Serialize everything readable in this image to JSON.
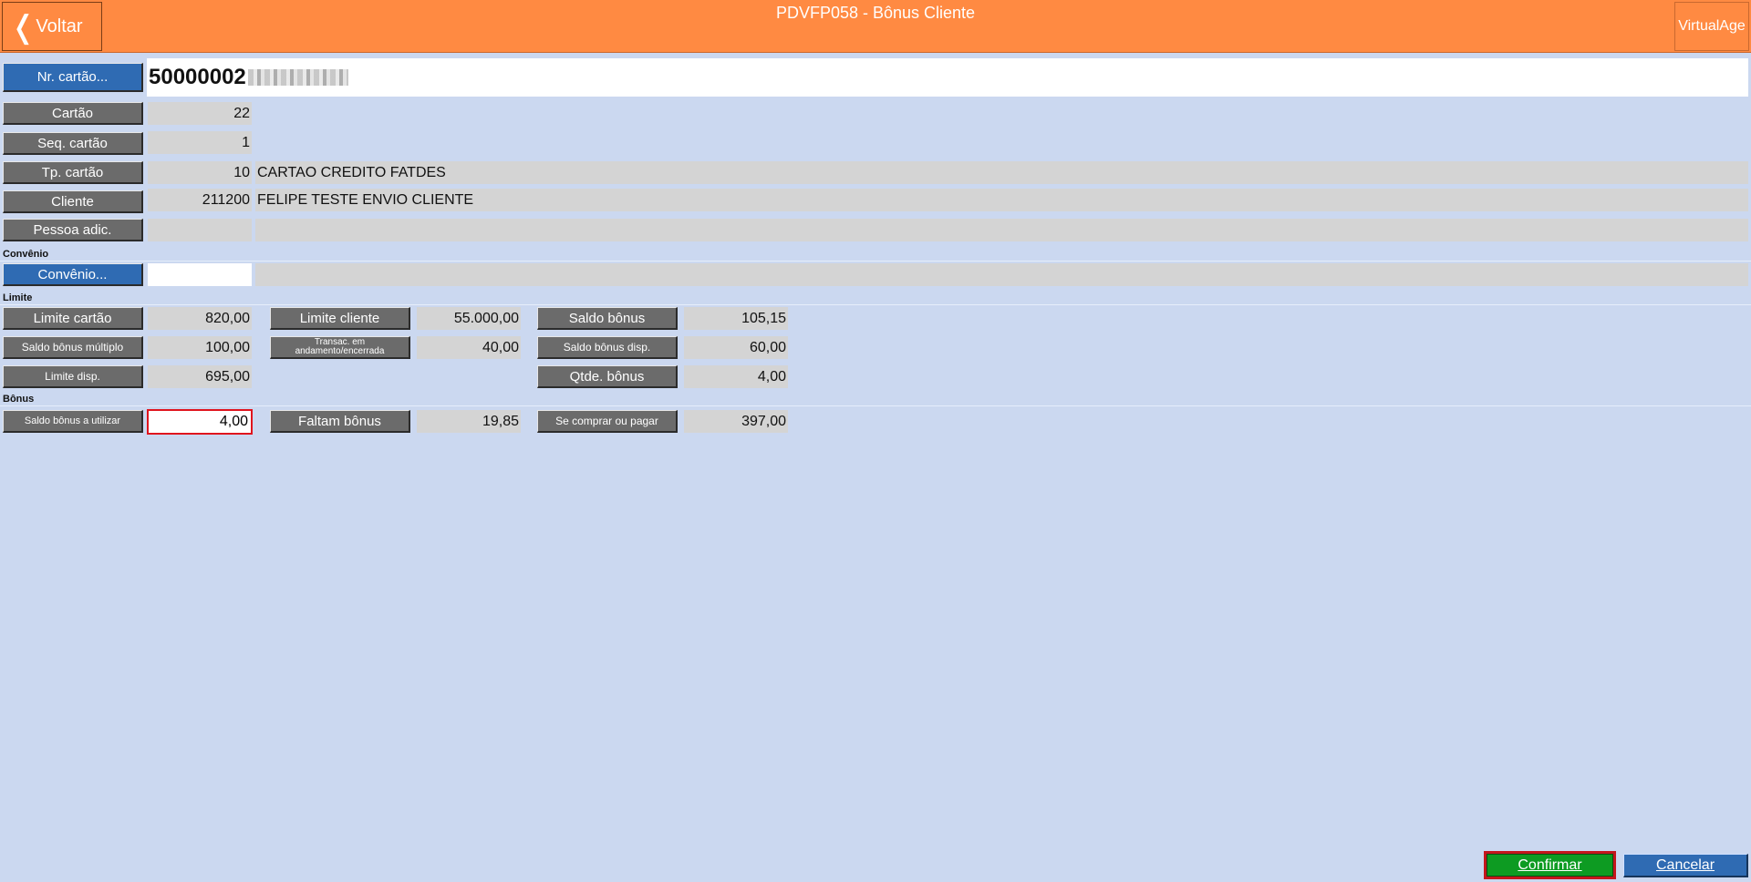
{
  "header": {
    "back_label": "Voltar",
    "title": "PDVFP058 - Bônus Cliente",
    "brand": "VirtualAge",
    "color": "#ff8a42"
  },
  "card": {
    "label": "Nr. cartão...",
    "value": "50000002"
  },
  "fields": {
    "cartao": {
      "label": "Cartão",
      "value": "22"
    },
    "seq_cartao": {
      "label": "Seq. cartão",
      "value": "1"
    },
    "tp_cartao": {
      "label": "Tp. cartão",
      "code": "10",
      "desc": "CARTAO CREDITO FATDES"
    },
    "cliente": {
      "label": "Cliente",
      "code": "211200",
      "desc": "FELIPE TESTE ENVIO CLIENTE"
    },
    "pessoa_adic": {
      "label": "Pessoa adic.",
      "code": "",
      "desc": ""
    }
  },
  "convenio": {
    "section": "Convênio",
    "label": "Convênio...",
    "code": "",
    "desc": ""
  },
  "limite": {
    "section": "Limite",
    "limite_cartao": {
      "label": "Limite cartão",
      "value": "820,00"
    },
    "limite_cliente": {
      "label": "Limite cliente",
      "value": "55.000,00"
    },
    "saldo_bonus": {
      "label": "Saldo bônus",
      "value": "105,15"
    },
    "saldo_bonus_multiplo": {
      "label": "Saldo bônus múltiplo",
      "value": "100,00"
    },
    "transac": {
      "label": "Transac. em andamento/encerrada",
      "value": "40,00"
    },
    "saldo_bonus_disp": {
      "label": "Saldo bônus disp.",
      "value": "60,00"
    },
    "limite_disp": {
      "label": "Limite disp.",
      "value": "695,00"
    },
    "qtde_bonus": {
      "label": "Qtde. bônus",
      "value": "4,00"
    }
  },
  "bonus": {
    "section": "Bônus",
    "saldo_utilizar": {
      "label": "Saldo bônus a utilizar",
      "value": "4,00"
    },
    "faltam_bonus": {
      "label": "Faltam bônus",
      "value": "19,85"
    },
    "se_comprar": {
      "label": "Se comprar ou pagar",
      "value": "397,00"
    }
  },
  "footer": {
    "confirm": "Confirmar",
    "cancel": "Cancelar"
  }
}
